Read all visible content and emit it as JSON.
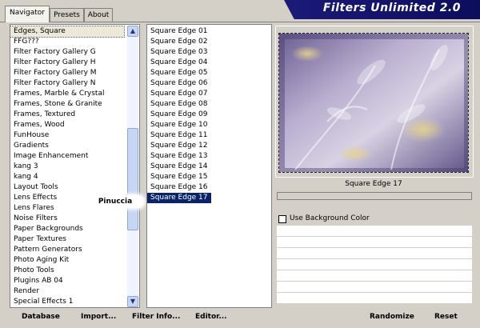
{
  "tabs": [
    {
      "label": "Navigator",
      "active": true
    },
    {
      "label": "Presets",
      "active": false
    },
    {
      "label": "About",
      "active": false
    }
  ],
  "title": "Filters Unlimited 2.0",
  "categories": [
    "Edges, Square",
    "FFG???",
    "Filter Factory Gallery G",
    "Filter Factory Gallery H",
    "Filter Factory Gallery M",
    "Filter Factory Gallery N",
    "Frames, Marble & Crystal",
    "Frames, Stone & Granite",
    "Frames, Textured",
    "Frames, Wood",
    "FunHouse",
    "Gradients",
    "Image Enhancement",
    "kang 3",
    "kang 4",
    "Layout Tools",
    "Lens Effects",
    "Lens Flares",
    "Noise Filters",
    "Paper Backgrounds",
    "Paper Textures",
    "Pattern Generators",
    "Photo Aging Kit",
    "Photo Tools",
    "Plugins AB 04",
    "Render",
    "Special Effects 1"
  ],
  "selected_category": "Edges, Square",
  "filters": [
    "Square Edge 01",
    "Square Edge 02",
    "Square Edge 03",
    "Square Edge 04",
    "Square Edge 05",
    "Square Edge 06",
    "Square Edge 07",
    "Square Edge 08",
    "Square Edge 09",
    "Square Edge 10",
    "Square Edge 11",
    "Square Edge 12",
    "Square Edge 13",
    "Square Edge 14",
    "Square Edge 15",
    "Square Edge 16",
    "Square Edge 17"
  ],
  "selected_filter": "Square Edge 17",
  "preview_label": "Square Edge 17",
  "progress": 0,
  "use_background_color": {
    "label": "Use Background Color",
    "checked": false
  },
  "watermark": "Pinuccia",
  "buttons": {
    "database": "Database",
    "import": "Import...",
    "filter_info": "Filter Info...",
    "editor": "Editor...",
    "randomize": "Randomize",
    "reset": "Reset"
  },
  "icons": {
    "scroll_up": "scroll-up-arrow-icon",
    "scroll_down": "scroll-down-arrow-icon"
  },
  "colors": {
    "banner": "#1b1b7a",
    "selection": "#0a246a",
    "dialog_bg": "#d4d0c8"
  }
}
